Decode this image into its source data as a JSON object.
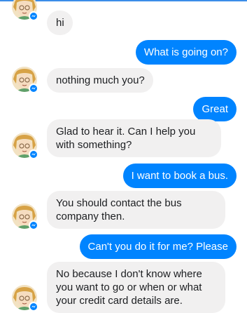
{
  "conversation": {
    "messages": [
      {
        "side": "received",
        "text": "hi"
      },
      {
        "side": "sent",
        "text": "What is going on?"
      },
      {
        "side": "received",
        "text": "nothing much you?"
      },
      {
        "side": "sent",
        "text": "Great"
      },
      {
        "side": "received",
        "text": "Glad to hear it. Can I help you with something?"
      },
      {
        "side": "sent",
        "text": "I want to book a bus."
      },
      {
        "side": "received",
        "text": "You should contact the bus company then."
      },
      {
        "side": "sent",
        "text": "Can't you do it for me? Please"
      },
      {
        "side": "received",
        "text": "No because I don't know where you want to go or when or what your credit card details are."
      }
    ]
  },
  "colors": {
    "sent_bubble": "#0084ff",
    "received_bubble": "#f1f0f0",
    "accent_line": "#3b8de8"
  },
  "icons": {
    "avatar": "cartoon-profile-avatar",
    "badge": "messenger-badge-icon"
  }
}
